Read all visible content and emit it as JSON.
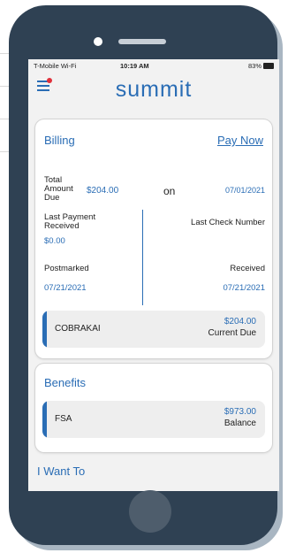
{
  "status": {
    "carrier": "T-Mobile Wi-Fi",
    "time": "10:19 AM",
    "battery": "83%"
  },
  "app": {
    "logo": "summit"
  },
  "billing": {
    "title": "Billing",
    "pay_now": "Pay Now",
    "total_label_1": "Total",
    "total_label_2": "Amount",
    "total_label_3": "Due",
    "total_amount": "$204.00",
    "on_label": "on",
    "due_date": "07/01/2021",
    "last_payment_label_1": "Last Payment",
    "last_payment_label_2": "Received",
    "last_payment_value": "$0.00",
    "last_check_label": "Last Check Number",
    "postmarked_label": "Postmarked",
    "postmarked_value": "07/21/2021",
    "received_label": "Received",
    "received_value": "07/21/2021",
    "account_name": "COBRAKAI",
    "account_amount": "$204.00",
    "account_sub": "Current Due"
  },
  "benefits": {
    "title": "Benefits",
    "item_name": "FSA",
    "item_amount": "$973.00",
    "item_sub": "Balance"
  },
  "i_want_to": "I Want To",
  "colors": {
    "accent": "#2a6db5",
    "phone_body": "#2f4153",
    "badge": "#e0303a"
  }
}
